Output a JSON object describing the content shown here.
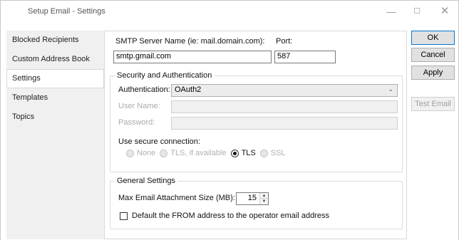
{
  "window": {
    "title": "Setup Email - Settings",
    "controls": {
      "minimize": "—",
      "maximize": "☐",
      "close": "✕"
    }
  },
  "sidebar": {
    "items": [
      {
        "label": "Blocked Recipients",
        "active": false
      },
      {
        "label": "Custom Address Book",
        "active": false
      },
      {
        "label": "Settings",
        "active": true
      },
      {
        "label": "Templates",
        "active": false
      },
      {
        "label": "Topics",
        "active": false
      }
    ]
  },
  "smtp": {
    "server_label": "SMTP Server Name (ie: mail.domain.com):",
    "server_value": "smtp.gmail.com",
    "port_label": "Port:",
    "port_value": "587"
  },
  "security": {
    "group_title": "Security and Authentication",
    "auth_label": "Authentication:",
    "auth_value": "OAuth2",
    "username_label": "User Name:",
    "username_value": "",
    "password_label": "Password:",
    "password_value": "",
    "secure_label": "Use secure connection:",
    "options": [
      {
        "label": "None",
        "checked": false,
        "enabled": false
      },
      {
        "label": "TLS, if available",
        "checked": false,
        "enabled": false
      },
      {
        "label": "TLS",
        "checked": true,
        "enabled": true
      },
      {
        "label": "SSL",
        "checked": false,
        "enabled": false
      }
    ]
  },
  "general": {
    "group_title": "General Settings",
    "max_attach_label": "Max Email Attachment Size (MB):",
    "max_attach_value": "15",
    "default_from_label": "Default the FROM address to the operator email address",
    "default_from_checked": false
  },
  "buttons": {
    "ok": "OK",
    "cancel": "Cancel",
    "apply": "Apply",
    "test_email": "Test Email"
  }
}
